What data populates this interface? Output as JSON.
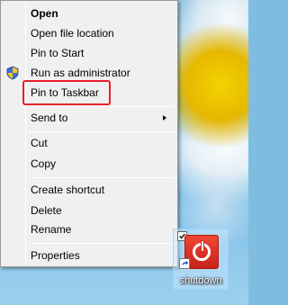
{
  "context_menu": {
    "items": [
      {
        "label": "Open",
        "bold": true
      },
      {
        "label": "Open file location"
      },
      {
        "label": "Pin to Start"
      },
      {
        "label": "Run as administrator",
        "icon": "uac-shield-icon"
      },
      {
        "label": "Pin to Taskbar",
        "highlighted": true
      },
      {
        "label": "Send to",
        "submenu": true
      },
      {
        "label": "Cut"
      },
      {
        "label": "Copy"
      },
      {
        "label": "Create shortcut"
      },
      {
        "label": "Delete"
      },
      {
        "label": "Rename"
      },
      {
        "label": "Properties"
      }
    ],
    "highlight_color": "#e8202a"
  },
  "desktop": {
    "icon": {
      "label": "shutdown",
      "icon": "power-icon",
      "color": "#d9291e",
      "checked": true
    }
  }
}
